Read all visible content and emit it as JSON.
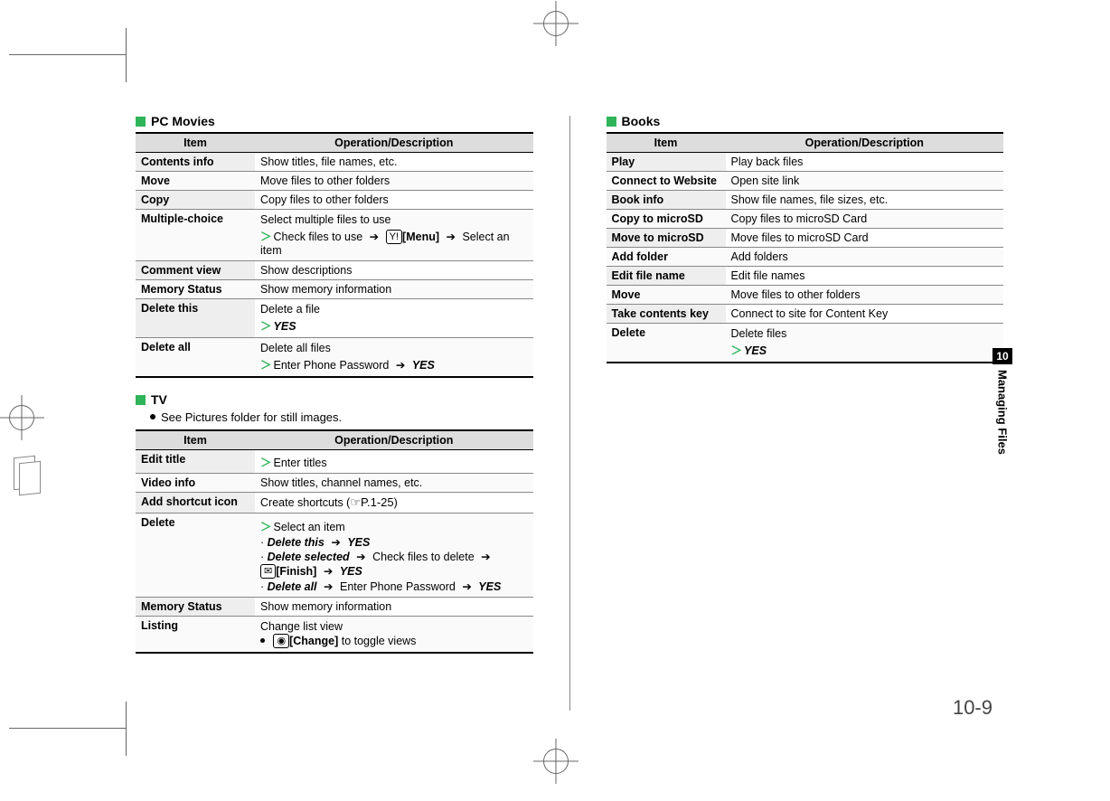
{
  "side_tab": "10",
  "side_label": "Managing Files",
  "page_number": "10-9",
  "sections": {
    "pcmovies": {
      "heading": "PC Movies"
    },
    "tv": {
      "heading": "TV",
      "note": "See Pictures folder for still images."
    },
    "books": {
      "heading": "Books"
    }
  },
  "columns": {
    "item": "Item",
    "desc": "Operation/Description"
  },
  "ui": {
    "chev": "＞",
    "arrow": "➔",
    "yes": "YES",
    "menu_key": "Y!",
    "menu_label": "[Menu]",
    "mail_key": "✉",
    "finish_label": "[Finish]",
    "cam_key": "◉",
    "change_label": "[Change]",
    "cross_ref": "☞P.1-25"
  },
  "pcmovies_rows": [
    {
      "item": "Contents info",
      "desc_plain": "Show titles, file names, etc."
    },
    {
      "item": "Move",
      "desc_plain": "Move files to other folders"
    },
    {
      "item": "Copy",
      "desc_plain": "Copy files to other folders"
    },
    {
      "item": "Multiple-choice",
      "line1": "Select multiple files to use",
      "line2_prefix": "Check files to use",
      "line2_suffix": "Select an item"
    },
    {
      "item": "Comment view",
      "desc_plain": "Show descriptions"
    },
    {
      "item": "Memory Status",
      "desc_plain": "Show memory information"
    },
    {
      "item": "Delete this",
      "line1": "Delete a file"
    },
    {
      "item": "Delete all",
      "line1": "Delete all files",
      "line2_prefix": "Enter Phone Password"
    }
  ],
  "tv_rows": {
    "edit_title": {
      "item": "Edit title",
      "text": "Enter titles"
    },
    "video_info": {
      "item": "Video info",
      "text": "Show titles, channel names, etc."
    },
    "add_shortcut": {
      "item": "Add shortcut icon",
      "text": "Create shortcuts ("
    },
    "delete": {
      "item": "Delete",
      "select": "Select an item",
      "opt1": "Delete this",
      "opt2": "Delete selected",
      "opt2_mid": "Check files to delete",
      "opt3": "Delete all",
      "opt3_mid": "Enter Phone Password"
    },
    "memory_status": {
      "item": "Memory Status",
      "text": "Show memory information"
    },
    "listing": {
      "item": "Listing",
      "line1": "Change list view",
      "line2_suffix": " to toggle views"
    }
  },
  "books_rows": [
    {
      "item": "Play",
      "desc": "Play back files"
    },
    {
      "item": "Connect to Website",
      "desc": "Open site link"
    },
    {
      "item": "Book info",
      "desc": "Show file names, file sizes, etc."
    },
    {
      "item": "Copy to microSD",
      "desc": "Copy files to microSD Card"
    },
    {
      "item": "Move to microSD",
      "desc": "Move files to microSD Card"
    },
    {
      "item": "Add folder",
      "desc": "Add folders"
    },
    {
      "item": "Edit file name",
      "desc": "Edit file names"
    },
    {
      "item": "Move",
      "desc": "Move files to other folders"
    },
    {
      "item": "Take contents key",
      "desc": "Connect to site for Content Key"
    },
    {
      "item": "Delete",
      "line1": "Delete files"
    }
  ]
}
